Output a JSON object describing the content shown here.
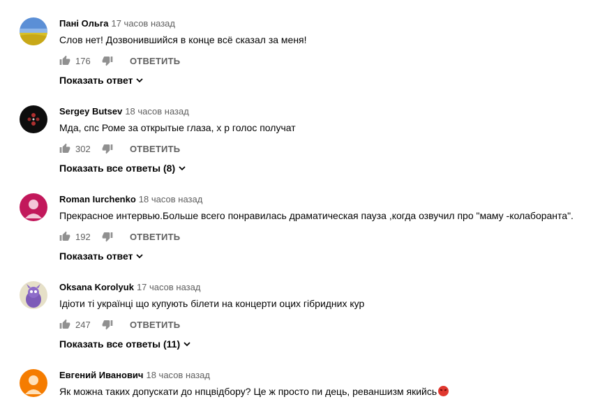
{
  "comments": [
    {
      "author": "Пані Ольга",
      "time": "17 часов назад",
      "text": "Слов нет! Дозвонившийся в конце всё сказал за меня!",
      "likes": "176",
      "reply_label": "ОТВЕТИТЬ",
      "replies_label": "Показать ответ",
      "avatar": "landscape-field"
    },
    {
      "author": "Sergey Butsev",
      "time": "18 часов назад",
      "text": "Мда, спс Роме за открытые глаза, х   р голос получат",
      "likes": "302",
      "reply_label": "ОТВЕТИТЬ",
      "replies_label": "Показать все ответы (8)",
      "avatar": "dark-pattern"
    },
    {
      "author": "Roman Iurchenko",
      "time": "18 часов назад",
      "text": "Прекрасное интервью.Больше всего понравилась  драматическая пауза ,когда озвучил про \"маму -колаборанта\".",
      "likes": "192",
      "reply_label": "ОТВЕТИТЬ",
      "replies_label": "Показать ответ",
      "avatar": "default-person-pink"
    },
    {
      "author": "Oksana Korolyuk",
      "time": "17 часов назад",
      "text": "Ідіоти ті українці що купують білети на концерти оцих гібридних кур",
      "likes": "247",
      "reply_label": "ОТВЕТИТЬ",
      "replies_label": "Показать все ответы (11)",
      "avatar": "cartoon-creature"
    },
    {
      "author": "Евгений Иванович",
      "time": "18 часов назад",
      "text": "Як можна таких допускати до нпцвідбору? Це ж просто пи   дець, реваншизм якийсь",
      "avatar": "default-person-orange",
      "emoji": "angry-face"
    }
  ],
  "colors": {
    "text": "#030303",
    "secondary": "#606060",
    "icon": "#909090",
    "avatar_pink": "#c2185b",
    "avatar_orange": "#f57c00"
  }
}
